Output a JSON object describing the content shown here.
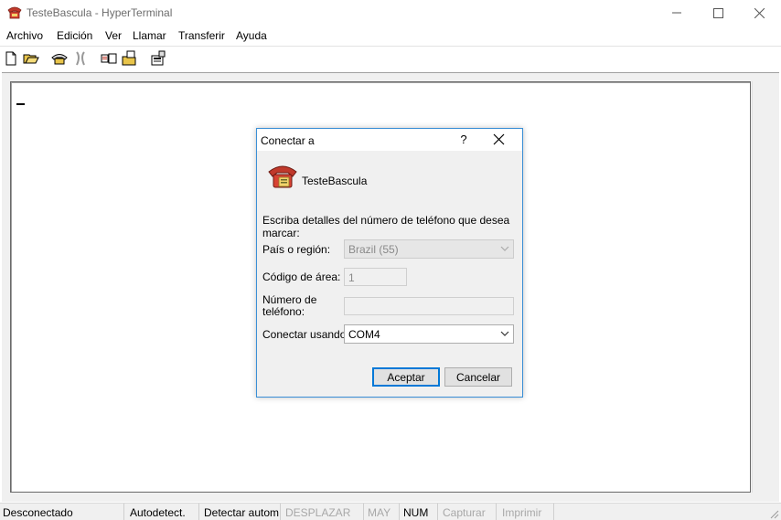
{
  "window": {
    "title": "TesteBascula - HyperTerminal",
    "icon": "hyperterminal-phone-icon"
  },
  "menu": {
    "items": [
      "Archivo",
      "Edición",
      "Ver",
      "Llamar",
      "Transferir",
      "Ayuda"
    ]
  },
  "toolbar": {
    "icons": [
      "new-file-icon",
      "open-folder-icon",
      "call-icon",
      "disconnect-icon",
      "send-file-icon",
      "receive-file-icon",
      "properties-icon"
    ]
  },
  "dialog": {
    "title": "Conectar a",
    "help": "?",
    "connection_name": "TesteBascula",
    "instructions": "Escriba detalles del número de teléfono que desea marcar:",
    "country_label": "País o región:",
    "country_value": "Brazil (55)",
    "area_code_label": "Código de área:",
    "area_code_value": "1",
    "phone_label_line1": "Número de",
    "phone_label_line2": "teléfono:",
    "phone_value": "",
    "connect_using_label": "Conectar usando:",
    "connect_using_value": "COM4",
    "ok_label": "Aceptar",
    "cancel_label": "Cancelar"
  },
  "statusbar": {
    "status": "Desconectado",
    "autodetect": "Autodetect.",
    "detect": "Detectar autom",
    "scroll": "DESPLAZAR",
    "caps": "MAY",
    "num": "NUM",
    "capture": "Capturar",
    "print": "Imprimir"
  },
  "colors": {
    "dialog_border": "#3a8fd6",
    "default_button_border": "#0078d7",
    "disabled_text": "#a8a8a8"
  }
}
